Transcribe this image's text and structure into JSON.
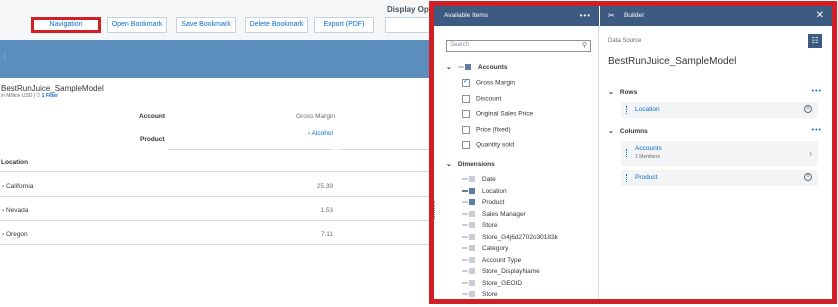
{
  "toolbar": {
    "navigation": "Navigation",
    "open_bookmark": "Open Bookmark",
    "save_bookmark": "Save Bookmark",
    "delete_bookmark": "Delete Bookmark",
    "export_pdf": "Export (PDF)",
    "display_options": "Display Op"
  },
  "report": {
    "title": "BestRunJuice_SampleModel",
    "unit": "in Million USD",
    "filter_label": "1 Filter",
    "col_headers": {
      "account": "Account",
      "product": "Product"
    },
    "measure_header": "Gross Margin",
    "product_header": "Alcohol",
    "row_dimension": "Location",
    "rows": [
      {
        "label": "California",
        "value": "25.39"
      },
      {
        "label": "Nevada",
        "value": "1.53"
      },
      {
        "label": "Oregon",
        "value": "7.11"
      }
    ]
  },
  "available_items": {
    "title": "Available Items",
    "search_placeholder": "Search",
    "accounts_header": "Accounts",
    "accounts": [
      {
        "label": "Gross Margin",
        "checked": true
      },
      {
        "label": "Discount",
        "checked": false
      },
      {
        "label": "Original Sales Price",
        "checked": false
      },
      {
        "label": "Price (fixed)",
        "checked": false
      },
      {
        "label": "Quantity sold",
        "checked": false
      }
    ],
    "dimensions_header": "Dimensions",
    "dimensions": [
      {
        "label": "Date",
        "icon": "dimension-icon"
      },
      {
        "label": "Location",
        "icon": "hierarchy-icon"
      },
      {
        "label": "Product",
        "icon": "measure-icon"
      },
      {
        "label": "Sales Manager",
        "icon": "dimension-icon"
      },
      {
        "label": "Store",
        "icon": "dimension-icon"
      },
      {
        "label": "Store_G4j6d2702o30183k",
        "icon": "dimension-icon"
      },
      {
        "label": "Category",
        "icon": "dimension-icon"
      },
      {
        "label": "Account Type",
        "icon": "dimension-icon"
      },
      {
        "label": "Store_DisplayName",
        "icon": "dimension-icon"
      },
      {
        "label": "Store_GEOID",
        "icon": "dimension-icon"
      },
      {
        "label": "Store",
        "icon": "dimension-icon"
      }
    ]
  },
  "builder": {
    "title": "Builder",
    "data_source_label": "Data Source",
    "data_source_name": "BestRunJuice_SampleModel",
    "rows_label": "Rows",
    "rows_items": [
      {
        "label": "Location"
      }
    ],
    "columns_label": "Columns",
    "columns_items": [
      {
        "label": "Accounts",
        "sub": "1 Members"
      },
      {
        "label": "Product"
      }
    ]
  },
  "colors": {
    "accent": "#0a6ed1",
    "panel_header": "#3d5a80",
    "highlight_outline": "#d01f25",
    "band": "#5b8dbd"
  }
}
